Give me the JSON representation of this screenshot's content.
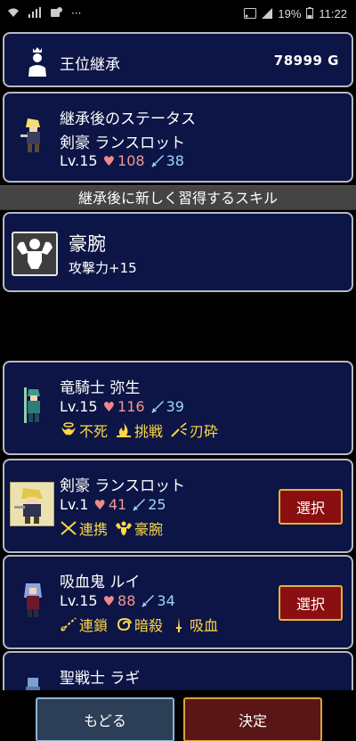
{
  "status_bar": {
    "time": "11:22",
    "battery": "19%",
    "dots": "···"
  },
  "header": {
    "title": "王位継承",
    "gold": "78999 G"
  },
  "inherit_status": {
    "title": "継承後のステータス",
    "name": "剣豪 ランスロット",
    "level": "Lv.15",
    "hp": "108",
    "atk": "38"
  },
  "banner": {
    "text": "継承後に新しく習得するスキル"
  },
  "new_skill": {
    "name": "豪腕",
    "effect": "攻撃力+15"
  },
  "candidates": [
    {
      "name": "竜騎士 弥生",
      "level": "Lv.15",
      "hp": "116",
      "atk": "39",
      "skills": [
        "不死",
        "挑戦",
        "刃砕"
      ],
      "select": ""
    },
    {
      "name": "剣豪 ランスロット",
      "level": "Lv.1",
      "hp": "41",
      "atk": "25",
      "skills": [
        "連携",
        "豪腕"
      ],
      "select": "選択"
    },
    {
      "name": "吸血鬼 ルイ",
      "level": "Lv.15",
      "hp": "88",
      "atk": "34",
      "skills": [
        "連鎖",
        "暗殺",
        "吸血"
      ],
      "select": "選択"
    },
    {
      "name": "聖戦士 ラギ"
    }
  ],
  "buttons": {
    "back": "もどる",
    "confirm": "決定"
  },
  "colors": {
    "panel_bg": "#0c1545",
    "panel_border": "#b9b9c4",
    "hp": "#f29898",
    "atk": "#9fd4ff",
    "skill": "#ffd84a",
    "select_bg": "#8a0f10",
    "select_border": "#e0b341"
  }
}
